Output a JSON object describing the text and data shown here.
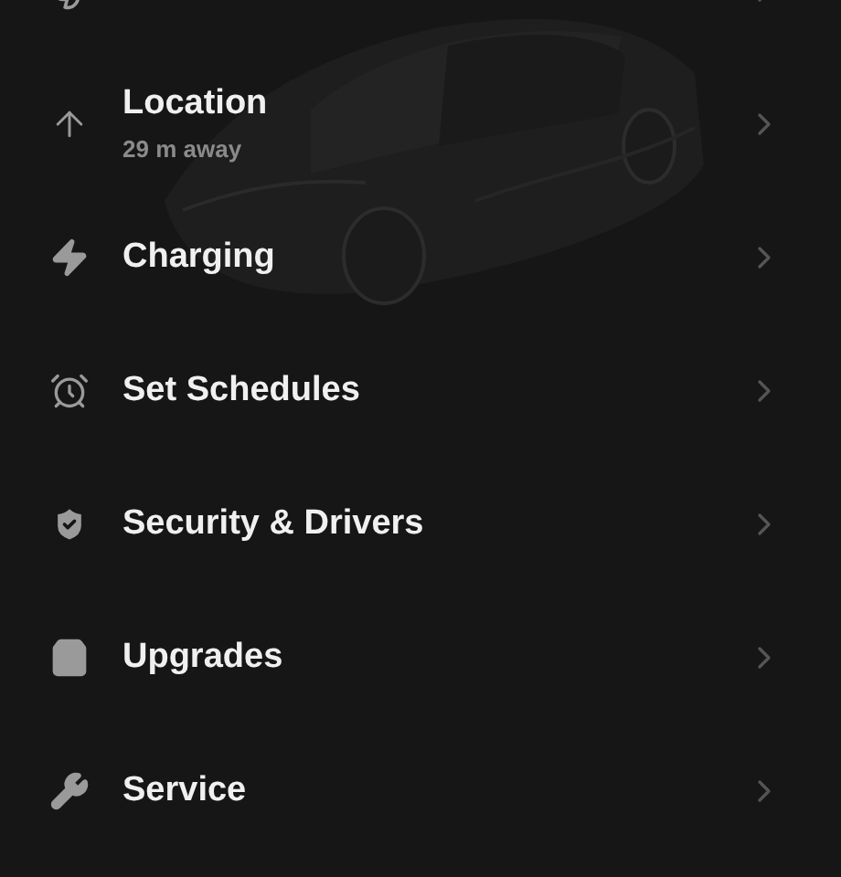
{
  "menu": {
    "items": [
      {
        "label": "Location",
        "subtitle": "29 m away"
      },
      {
        "label": "Charging"
      },
      {
        "label": "Set Schedules"
      },
      {
        "label": "Security & Drivers"
      },
      {
        "label": "Upgrades"
      },
      {
        "label": "Service"
      }
    ]
  }
}
